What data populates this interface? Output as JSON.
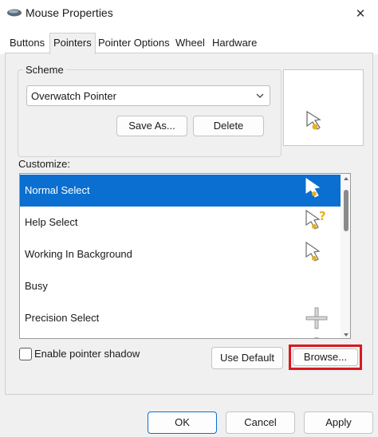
{
  "window": {
    "title": "Mouse Properties",
    "close_symbol": "✕"
  },
  "tabs": [
    {
      "label": "Buttons",
      "active": false
    },
    {
      "label": "Pointers",
      "active": true
    },
    {
      "label": "Pointer Options",
      "active": false
    },
    {
      "label": "Wheel",
      "active": false
    },
    {
      "label": "Hardware",
      "active": false
    }
  ],
  "scheme": {
    "label": "Scheme",
    "selected": "Overwatch Pointer",
    "save_as_label": "Save As...",
    "delete_label": "Delete"
  },
  "customize": {
    "label": "Customize:",
    "items": [
      {
        "label": "Normal Select",
        "selected": true,
        "icon": "arrow-cursor-icon"
      },
      {
        "label": "Help Select",
        "selected": false,
        "icon": "help-cursor-icon"
      },
      {
        "label": "Working In Background",
        "selected": false,
        "icon": "working-cursor-icon"
      },
      {
        "label": "Busy",
        "selected": false,
        "icon": "busy-cursor-icon"
      },
      {
        "label": "Precision Select",
        "selected": false,
        "icon": "crosshair-cursor-icon"
      }
    ]
  },
  "shadow": {
    "label": "Enable pointer shadow",
    "checked": false
  },
  "actions": {
    "use_default_label": "Use Default",
    "browse_label": "Browse..."
  },
  "footer": {
    "ok_label": "OK",
    "cancel_label": "Cancel",
    "apply_label": "Apply"
  },
  "colors": {
    "selection": "#0a6fd0",
    "highlight_box": "#d71920",
    "cursor_accent": "#e8b020"
  }
}
